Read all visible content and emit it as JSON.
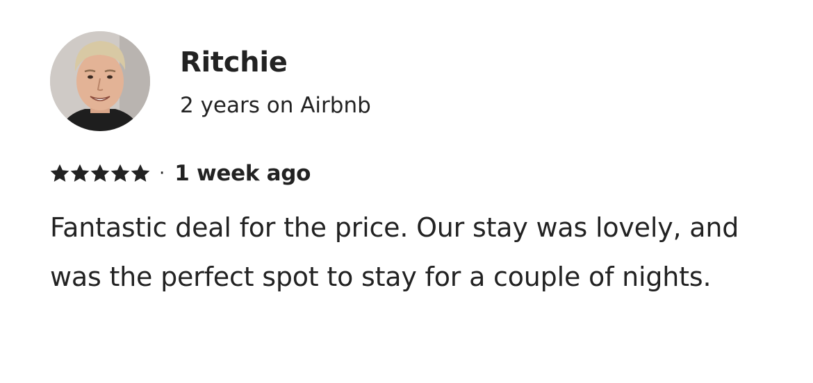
{
  "reviewer": {
    "name": "Ritchie",
    "tenure": "2 years on Airbnb",
    "avatar_icon": "user-photo"
  },
  "review": {
    "rating": 5,
    "rating_max": 5,
    "star_icon": "star-icon",
    "separator": "·",
    "date": "1 week ago",
    "text": "Fantastic deal for the price. Our stay was lovely, and was the perfect spot to stay for a couple of nights."
  },
  "colors": {
    "text": "#222222",
    "star": "#222222",
    "background": "#ffffff"
  }
}
